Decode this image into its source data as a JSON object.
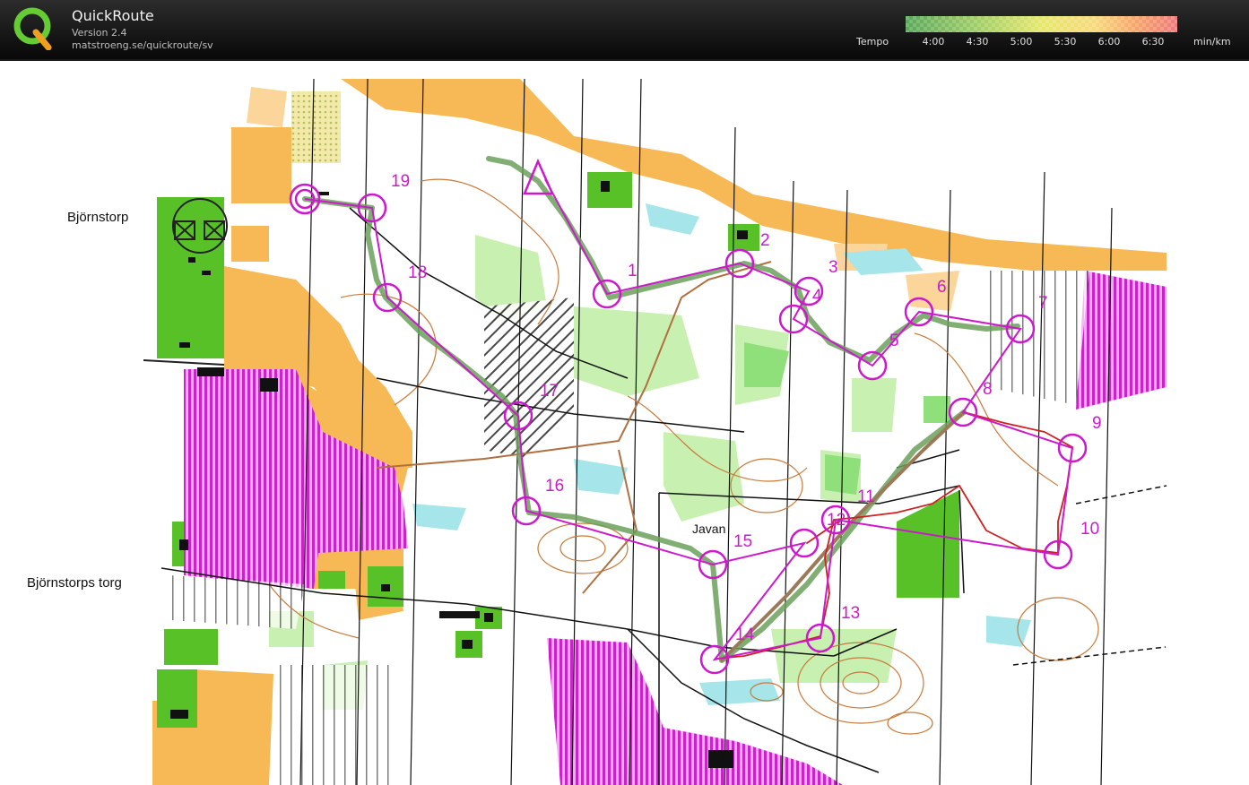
{
  "app": {
    "title": "QuickRoute",
    "version": "Version 2.4",
    "url": "matstroeng.se/quickroute/sv"
  },
  "tempo": {
    "label": "Tempo",
    "ticks": [
      "4:00",
      "4:30",
      "5:00",
      "5:30",
      "6:00",
      "6:30"
    ],
    "unit": "min/km",
    "colors": [
      "#5aa85a",
      "#9ccc66",
      "#e6e86a",
      "#f8d97a",
      "#f5a46a",
      "#f07a7a"
    ]
  },
  "map": {
    "places": {
      "bjornstorp": "Björnstorp",
      "bjornstorps_torg": "Björnstorps torg",
      "javan": "Javan"
    },
    "controls": [
      "1",
      "2",
      "3",
      "4",
      "5",
      "6",
      "7",
      "8",
      "9",
      "10",
      "11",
      "12",
      "13",
      "14",
      "15",
      "16",
      "17",
      "18",
      "19"
    ],
    "colors": {
      "course": "#cc19cc",
      "route_fast": "#6aa05a",
      "route_slow": "#d02020",
      "open": "#f7b955",
      "forest_green": "#58c127",
      "out_of_bounds": "#cc22cc"
    }
  }
}
